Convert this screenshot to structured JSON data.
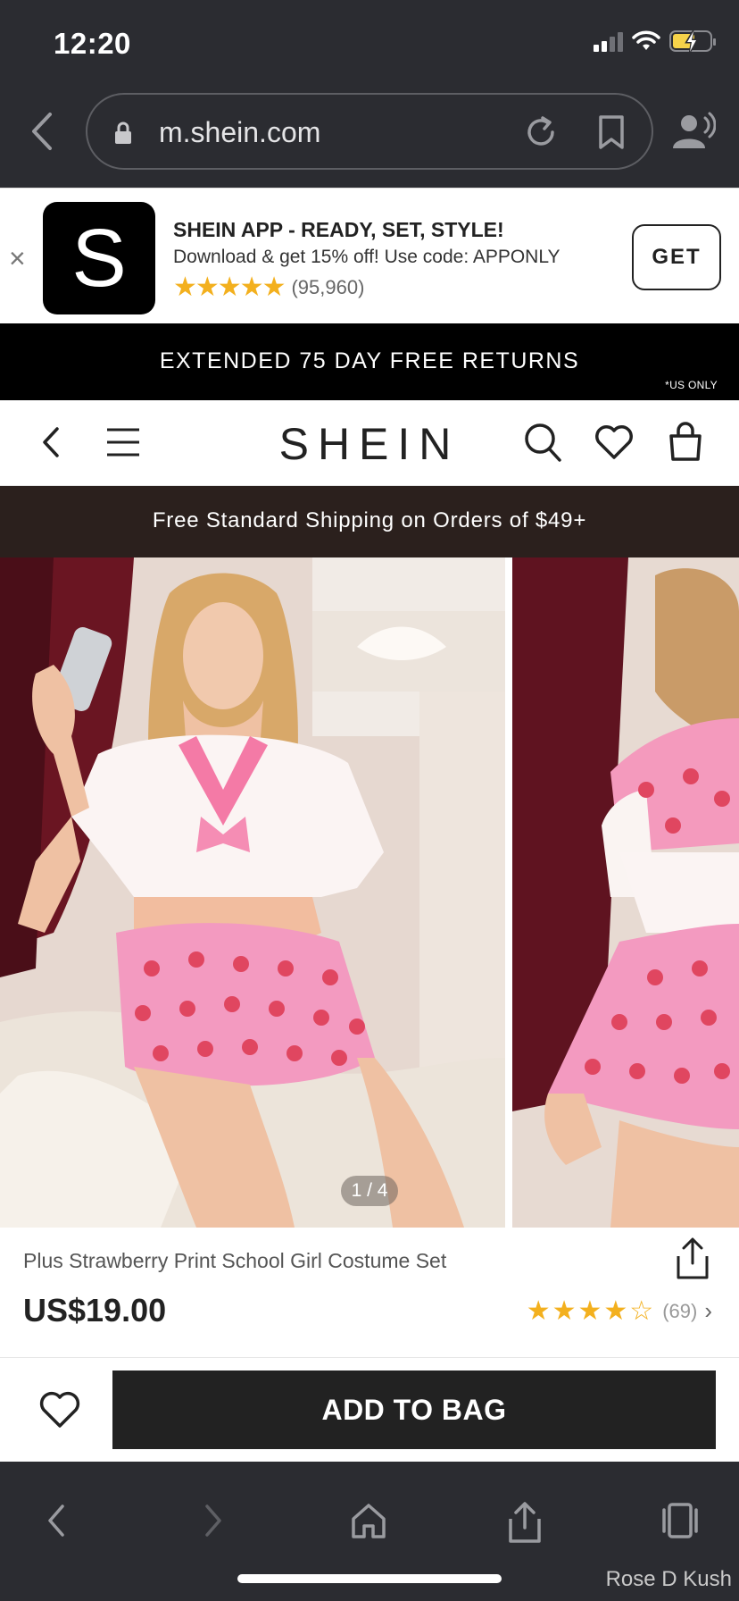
{
  "status_bar": {
    "time": "12:20"
  },
  "browser": {
    "url": "m.shein.com"
  },
  "app_banner": {
    "logo_letter": "S",
    "title": "SHEIN APP - READY, SET, STYLE!",
    "subtitle": "Download & get 15% off! Use code: APPONLY",
    "stars": "★★★★★",
    "rating_count": "(95,960)",
    "get_label": "GET",
    "close_symbol": "×"
  },
  "promo": {
    "text": "EXTENDED 75 DAY FREE RETURNS",
    "note": "*US ONLY"
  },
  "site_header": {
    "brand": "SHEIN"
  },
  "shipping_bar": {
    "text": "Free Standard Shipping on Orders of $49+"
  },
  "gallery": {
    "counter": "1 / 4",
    "current": 1,
    "total": 4
  },
  "product": {
    "name": "Plus Strawberry Print School Girl Costume Set",
    "price": "US$19.00",
    "stars": "★★★★☆",
    "rating": 4.5,
    "review_count": "(69)",
    "chevron": "›"
  },
  "actions": {
    "add_to_bag": "ADD TO BAG"
  },
  "watermark": "Rose D Kush",
  "colors": {
    "chrome": "#2b2c31",
    "star": "#f3b01e",
    "shipping_bar": "#2b201d",
    "button": "#222222"
  },
  "icons": [
    "back-icon",
    "lock-icon",
    "reload-icon",
    "bookmark-icon",
    "speaker-icon",
    "close-icon",
    "menu-icon",
    "search-icon",
    "heart-icon",
    "bag-icon",
    "share-icon",
    "forward-icon",
    "home-icon",
    "tabs-icon"
  ]
}
